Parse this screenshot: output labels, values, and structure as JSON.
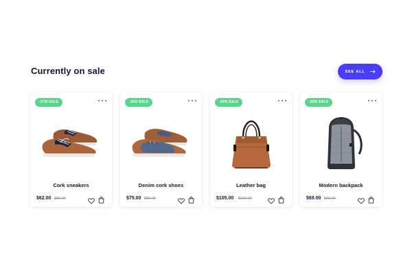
{
  "section": {
    "title": "Currently on sale",
    "see_all_label": "SEE ALL"
  },
  "colors": {
    "accent": "#4a3cf7",
    "sale_badge": "#5dd48e"
  },
  "products": [
    {
      "name": "Cork sneakers",
      "price": "$62.00",
      "old_price": "$85.00",
      "badge": "-27% SALE",
      "image": "shoe-image"
    },
    {
      "name": "Denim cork shoes",
      "price": "$75.00",
      "old_price": "$89.00",
      "badge": "-16% SALE",
      "image": "shoe-image"
    },
    {
      "name": "Leather bag",
      "price": "$105.00",
      "old_price": "$159.00",
      "badge": "-34% SALE",
      "image": "handbag-image"
    },
    {
      "name": "Modern backpack",
      "price": "$69.00",
      "old_price": "$96.00",
      "badge": "-28% SALE",
      "image": "backpack-image"
    }
  ]
}
